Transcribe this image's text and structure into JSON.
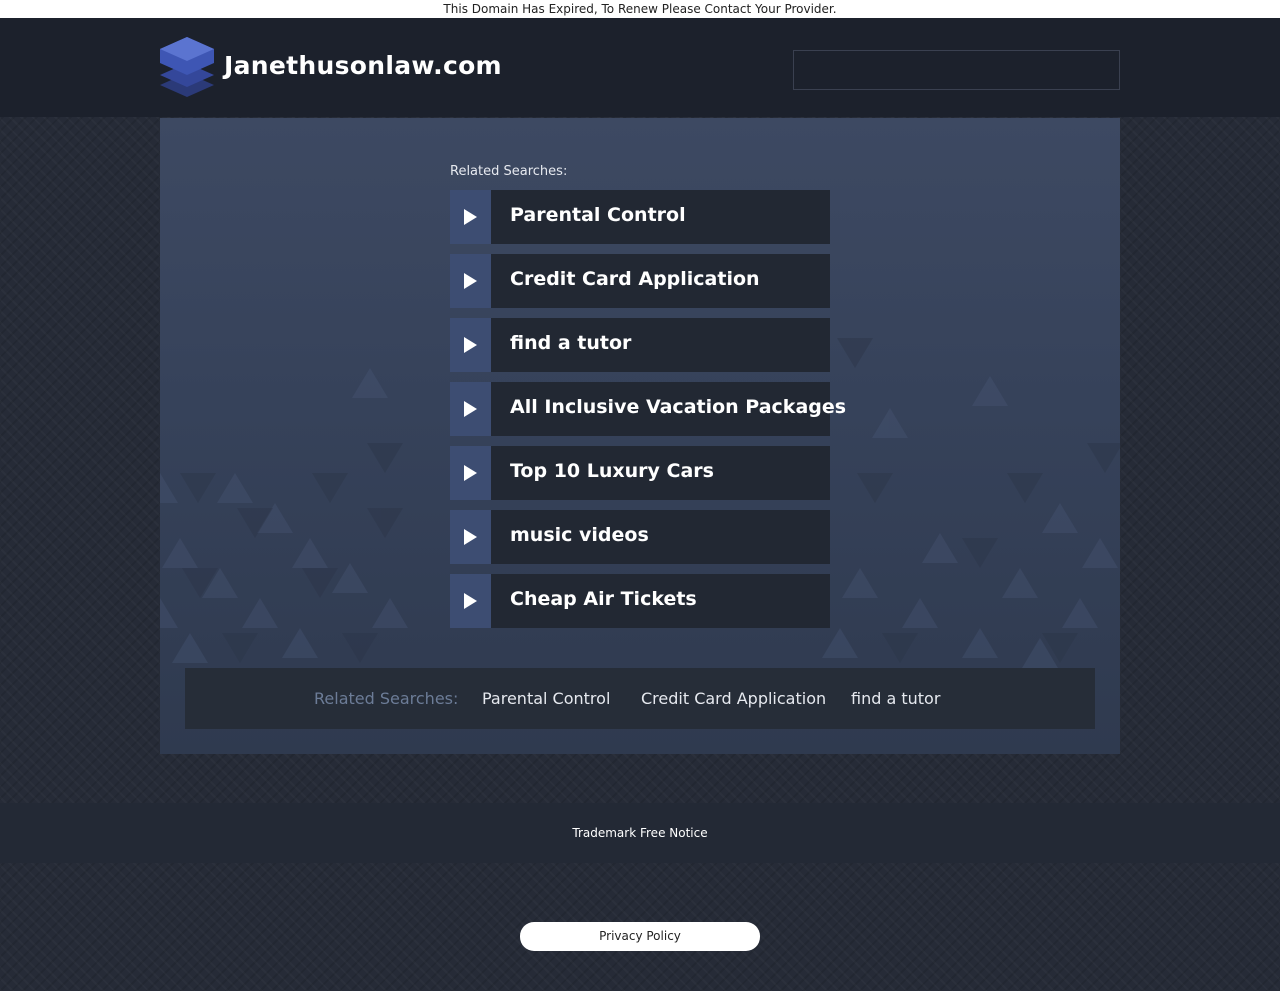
{
  "notice_bar": {
    "text": "This Domain Has Expired, To Renew Please Contact Your Provider."
  },
  "header": {
    "site_name": "Janethusonlaw.com",
    "search": {
      "value": "",
      "placeholder": ""
    }
  },
  "main": {
    "related_heading": "Related Searches:",
    "links": [
      {
        "label": "Parental Control"
      },
      {
        "label": "Credit Card Application"
      },
      {
        "label": "find a tutor"
      },
      {
        "label": "All Inclusive Vacation Packages"
      },
      {
        "label": "Top 10 Luxury Cars"
      },
      {
        "label": "music videos"
      },
      {
        "label": "Cheap Air Tickets"
      }
    ],
    "bottom_links": {
      "heading": "Related Searches:",
      "items": [
        {
          "label": "Parental Control"
        },
        {
          "label": "Credit Card Application"
        },
        {
          "label": "find a tutor"
        }
      ]
    }
  },
  "footer": {
    "trademark": "Trademark Free Notice",
    "privacy": "Privacy Policy"
  },
  "icons": {
    "logo": "stacked-layers-icon",
    "link_arrow": "play-arrow-icon"
  },
  "colors": {
    "header_bg": "#1c212c",
    "panel_bg": "#3d4962",
    "arrow_block": "#3d4d72",
    "link_block": "#222833",
    "muted_text": "#6c7c97"
  }
}
